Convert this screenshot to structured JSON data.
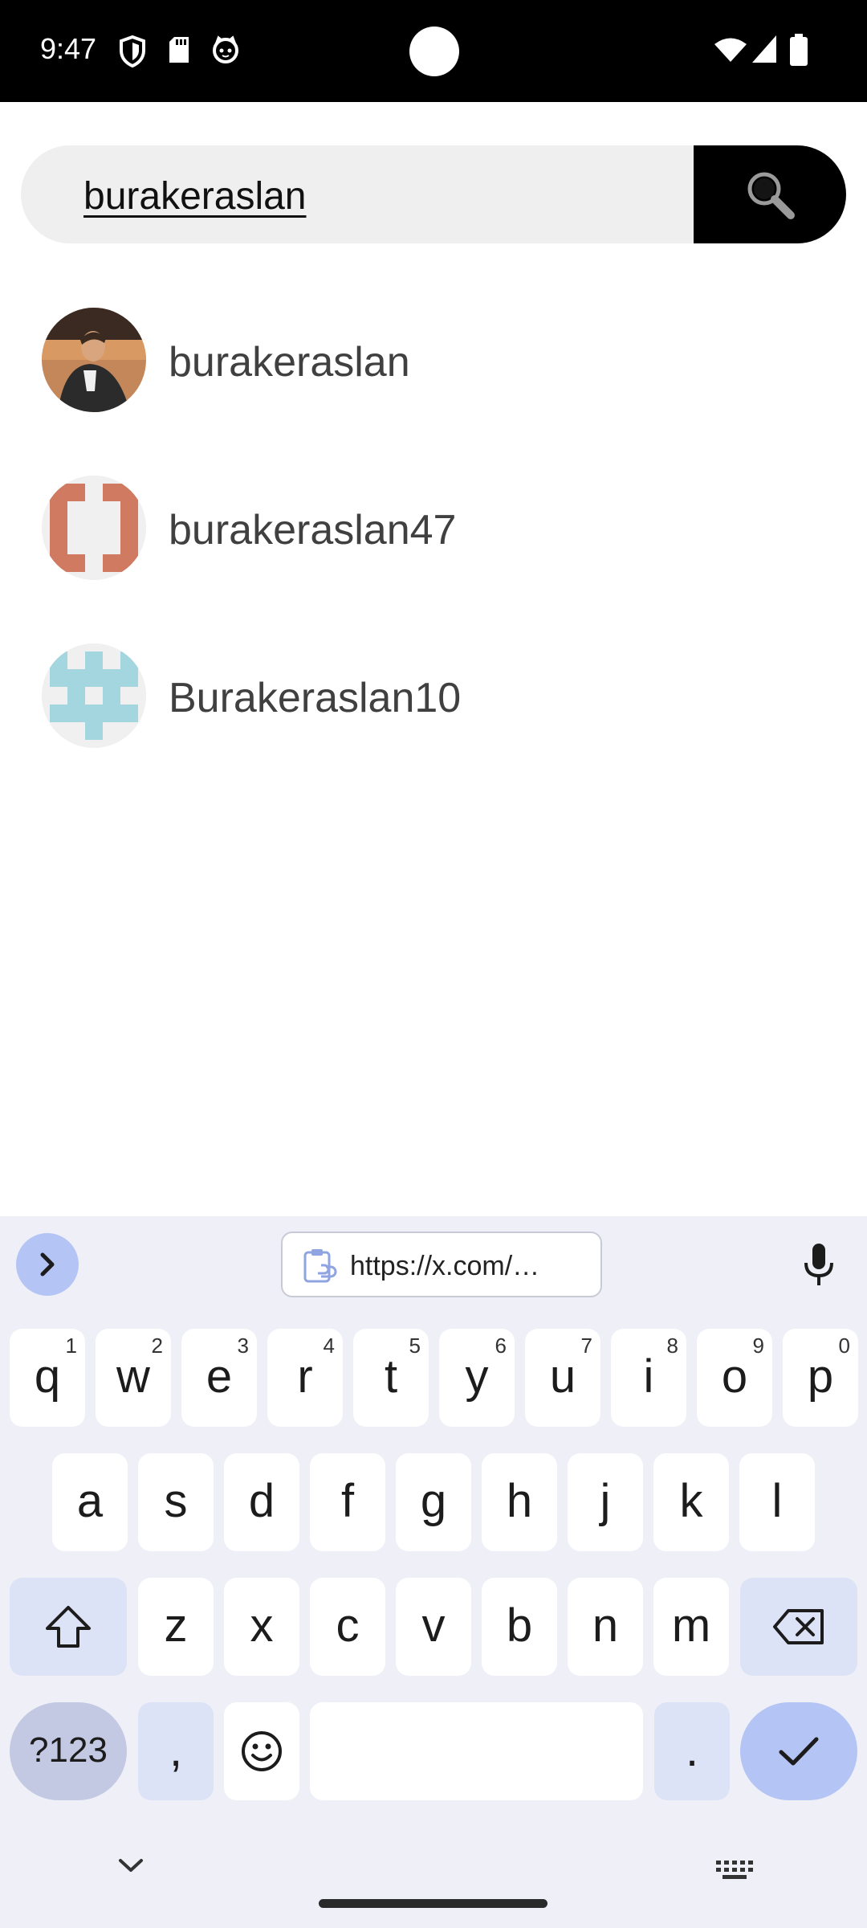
{
  "status_bar": {
    "time": "9:47",
    "icons": [
      "shield-icon",
      "sd-card-icon",
      "cat-icon",
      "wifi-icon",
      "signal-icon",
      "battery-icon"
    ]
  },
  "search": {
    "query": "burakeraslan",
    "button_icon": "search-icon"
  },
  "results": [
    {
      "name": "burakeraslan",
      "avatar": "photo-avatar"
    },
    {
      "name": "burakeraslan47",
      "avatar": "identicon-orange-avatar"
    },
    {
      "name": "Burakeraslan10",
      "avatar": "identicon-blue-avatar"
    }
  ],
  "keyboard": {
    "clipboard_text": "https://x.com/…",
    "row1": [
      {
        "key": "q",
        "sup": "1"
      },
      {
        "key": "w",
        "sup": "2"
      },
      {
        "key": "e",
        "sup": "3"
      },
      {
        "key": "r",
        "sup": "4"
      },
      {
        "key": "t",
        "sup": "5"
      },
      {
        "key": "y",
        "sup": "6"
      },
      {
        "key": "u",
        "sup": "7"
      },
      {
        "key": "i",
        "sup": "8"
      },
      {
        "key": "o",
        "sup": "9"
      },
      {
        "key": "p",
        "sup": "0"
      }
    ],
    "row2": [
      "a",
      "s",
      "d",
      "f",
      "g",
      "h",
      "j",
      "k",
      "l"
    ],
    "row3": [
      "z",
      "x",
      "c",
      "v",
      "b",
      "n",
      "m"
    ],
    "symbols_label": "?123",
    "comma_label": ",",
    "period_label": ".",
    "colors": {
      "background": "#eff0f7",
      "key": "#ffffff",
      "modifier": "#dde3f7",
      "accent": "#b4c4f5"
    }
  }
}
